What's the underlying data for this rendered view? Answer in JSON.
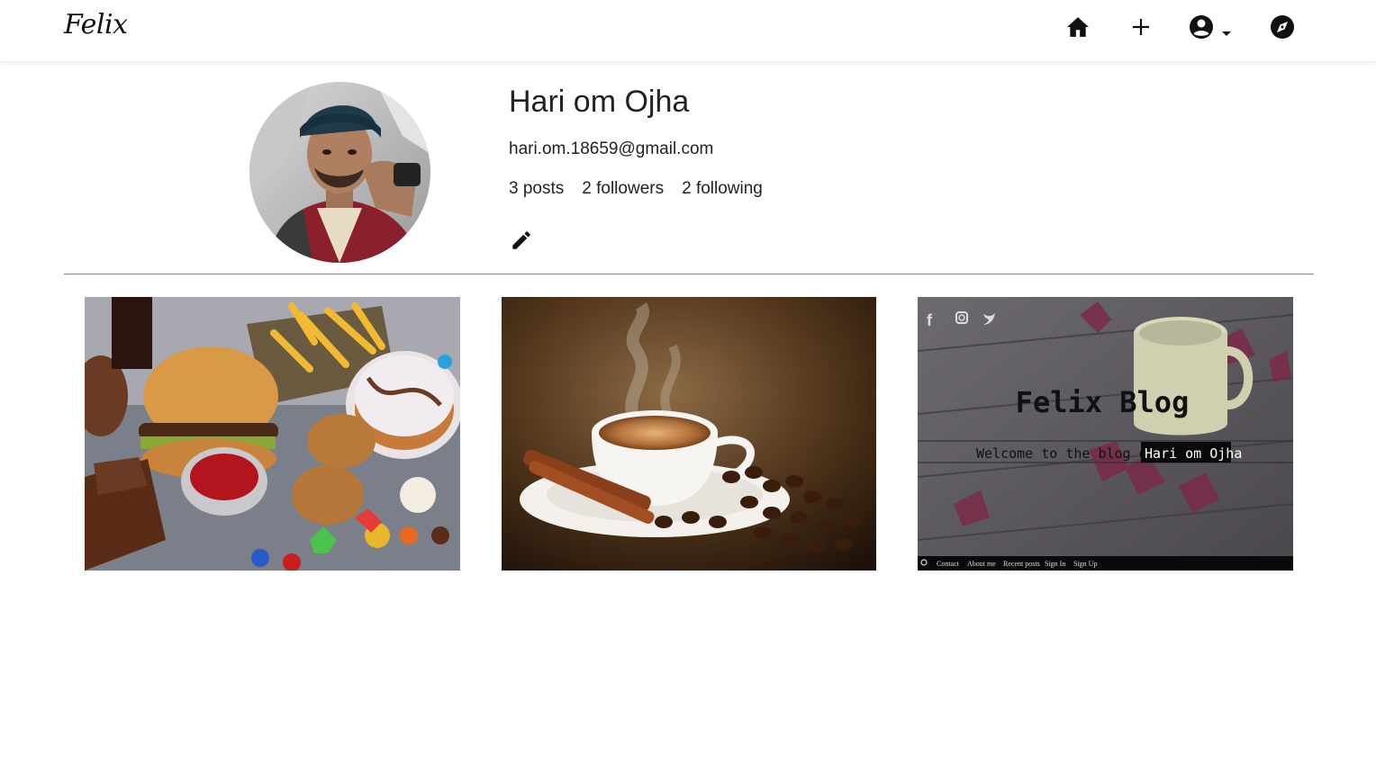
{
  "app": {
    "logo": "Felix"
  },
  "nav": {
    "icons": [
      "home-icon",
      "plus-icon",
      "account-circle-icon",
      "caret-down-icon",
      "compass-icon"
    ]
  },
  "profile": {
    "name": "Hari om Ojha",
    "email": "hari.om.18659@gmail.com",
    "posts": "3 posts",
    "followers": "2 followers",
    "following": "2 following",
    "edit_icon": "pencil-icon"
  },
  "posts": [
    {
      "description": "food-photo"
    },
    {
      "description": "coffee-photo"
    },
    {
      "description": "blog-screenshot",
      "title": "Felix Blog",
      "subtitle_prefix": "Welcome to the blog of",
      "subtitle_name": "Hari om Ojha",
      "menu": [
        "Contact",
        "About me",
        "Recent posts",
        "Sign In",
        "Sign Up"
      ]
    }
  ],
  "colors": {
    "background": "#ffffff",
    "text": "#222222",
    "divider": "#8a8a8a",
    "nav_icon": "#111111"
  }
}
